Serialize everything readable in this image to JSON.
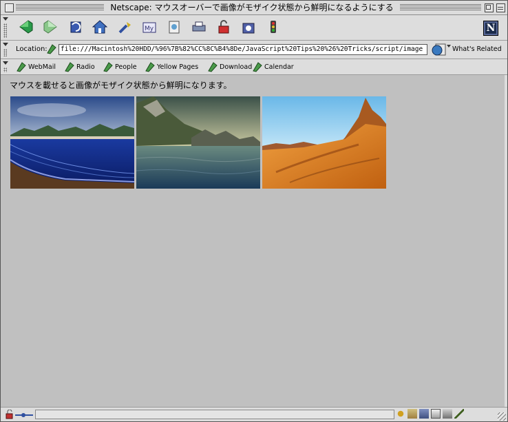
{
  "window": {
    "title": "Netscape: マウスオーバーで画像がモザイク状態から鮮明になるようにする"
  },
  "navbar": {
    "buttons": [
      {
        "icon": "back-icon",
        "color": "#2a9a4a"
      },
      {
        "icon": "forward-icon",
        "color": "#7ac07a"
      },
      {
        "icon": "reload-icon",
        "color": "#2a4aa0"
      },
      {
        "icon": "home-icon",
        "color": "#3060b0"
      },
      {
        "icon": "search-icon",
        "color": "#c0a020"
      },
      {
        "icon": "my-netscape-icon",
        "color": "#6060b0"
      },
      {
        "icon": "images-icon",
        "color": "#4080c0"
      },
      {
        "icon": "print-icon",
        "color": "#7080a0"
      },
      {
        "icon": "security-icon",
        "color": "#c03030"
      },
      {
        "icon": "shop-icon",
        "color": "#5060a0"
      },
      {
        "icon": "stop-icon",
        "color": "#c02020"
      }
    ],
    "logo_letter": "N"
  },
  "location": {
    "label": "Location:",
    "url": "file:///Macintosh%20HDD/%96%7B%82%CC%8C%B4%8De/JavaScript%20Tips%20%26%20Tricks/script/image",
    "related_label": "What's Related"
  },
  "personal_toolbar": {
    "items": [
      "WebMail",
      "Radio",
      "People",
      "Yellow Pages",
      "Download",
      "Calendar"
    ]
  },
  "content": {
    "text": "マウスを載せると画像がモザイク状態から鮮明になります。",
    "images": [
      {
        "name": "beach-landscape-image"
      },
      {
        "name": "sea-mountain-image"
      },
      {
        "name": "desert-mountain-image"
      }
    ]
  },
  "colors": {
    "content_bg": "#c0c0c0",
    "chrome_bg": "#dddddd"
  }
}
